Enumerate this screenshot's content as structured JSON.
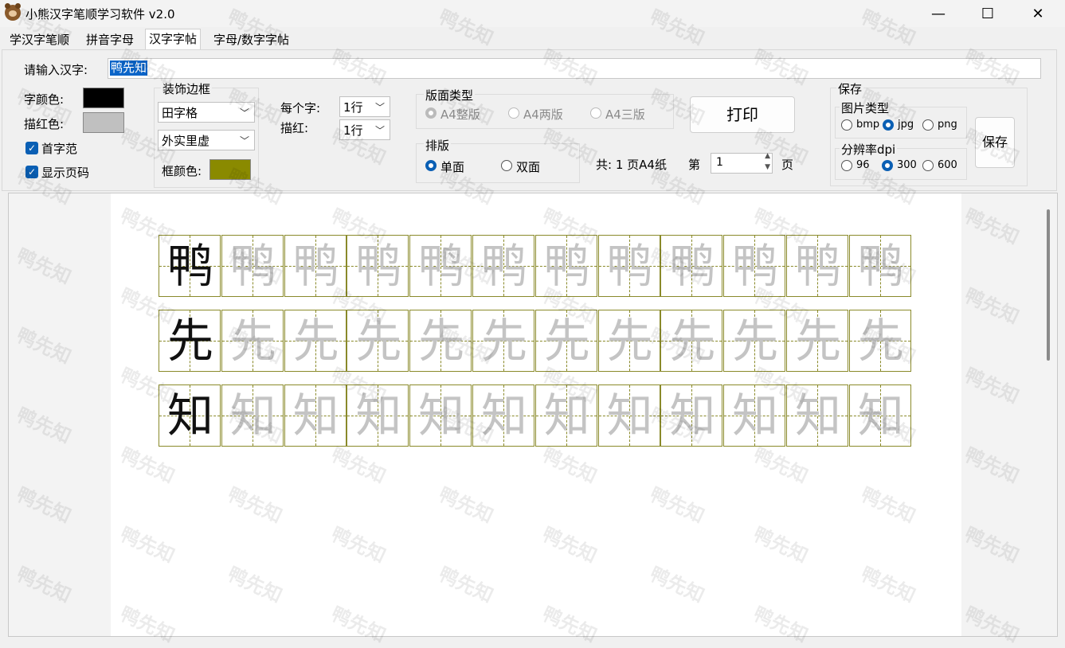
{
  "window": {
    "title": "小熊汉字笔顺学习软件 v2.0",
    "controls": [
      "—",
      "☐",
      "✕"
    ]
  },
  "tabs": [
    "学汉字笔顺",
    "拼音字母",
    "汉字字帖",
    "字母/数字字帖"
  ],
  "active_tab": 2,
  "input": {
    "label": "请输入汉字:",
    "value": "鸭先知"
  },
  "colors": {
    "label_font": "字颜色:",
    "font_color": "#000000",
    "label_trace": "描红色:",
    "trace_color": "#c0c0c0"
  },
  "checks": {
    "first_model": "首字范",
    "show_page": "显示页码"
  },
  "border": {
    "group_title": "装饰边框",
    "grid_type": "田字格",
    "line_style": "外实里虚",
    "frame_color_label": "框颜色:",
    "frame_color": "#8a8a00"
  },
  "per_char": {
    "label": "每个字:",
    "value": "1行",
    "trace_label": "描红:",
    "trace_value": "1行"
  },
  "layout_type": {
    "title": "版面类型",
    "opts": [
      "A4整版",
      "A4两版",
      "A4三版"
    ]
  },
  "typeset": {
    "title": "排版",
    "opts": [
      "单面",
      "双面"
    ]
  },
  "print_label": "打印",
  "pages": {
    "total": "共: 1 页A4纸",
    "page_prefix": "第",
    "page_value": "1",
    "page_suffix": "页"
  },
  "save": {
    "title": "保存",
    "img_type_title": "图片类型",
    "img_types": [
      "bmp",
      "jpg",
      "png"
    ],
    "dpi_title": "分辨率dpi",
    "dpis": [
      "96",
      "300",
      "600"
    ],
    "button": "保存"
  },
  "grid_chars": [
    "鸭",
    "先",
    "知"
  ],
  "cells_per_row": 12,
  "watermark": "鸭先知"
}
